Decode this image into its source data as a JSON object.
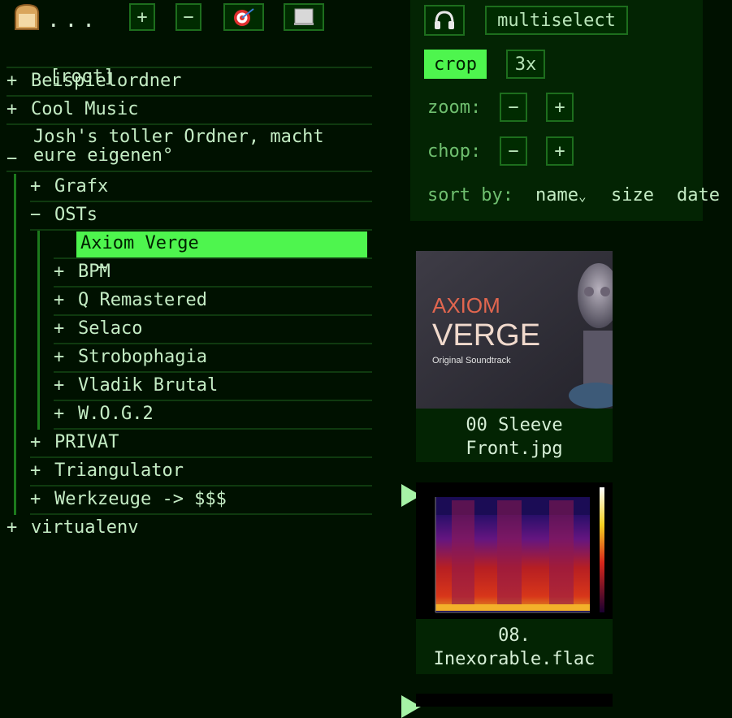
{
  "toolbar": {
    "dots": "...",
    "expand_label": "+",
    "collapse_label": "−",
    "bread_icon": "bread-icon",
    "target_icon": "target-icon",
    "sheet_icon": "sheet-icon"
  },
  "tree": {
    "root_label": "[root]",
    "items": [
      {
        "marker": "+",
        "label": "Beispielordner"
      },
      {
        "marker": "+",
        "label": "Cool Music"
      },
      {
        "marker": "−",
        "label_line1": "Josh's toller Ordner, macht",
        "label_line2": "eure eigenen°"
      },
      {
        "marker": "+",
        "label": "Grafx"
      },
      {
        "marker": "−",
        "label": "OSTs"
      },
      {
        "marker": "−",
        "label": "Axiom Verge"
      },
      {
        "marker": "+",
        "label": "BPM"
      },
      {
        "marker": "+",
        "label": "Q Remastered"
      },
      {
        "marker": "+",
        "label": "Selaco"
      },
      {
        "marker": "+",
        "label": "Strobophagia"
      },
      {
        "marker": "+",
        "label": "Vladik Brutal"
      },
      {
        "marker": "+",
        "label": "W.O.G.2"
      },
      {
        "marker": "+",
        "label": "PRIVAT"
      },
      {
        "marker": "+",
        "label": "Triangulator"
      },
      {
        "marker": "+",
        "label": "Werkzeuge -> $$$"
      },
      {
        "marker": "+",
        "label": "virtualenv"
      }
    ]
  },
  "panel": {
    "headphones_icon": "headphones-icon",
    "multiselect_label": "multiselect",
    "crop_label": "crop",
    "scale_label": "3x",
    "zoom_label": "zoom:",
    "chop_label": "chop:",
    "minus_label": "−",
    "plus_label": "+",
    "sort_label": "sort by:",
    "sort_options": [
      "name",
      "size",
      "date"
    ],
    "sort_selected": "name",
    "sort_indicator": "⌄"
  },
  "files": [
    {
      "name_line1": "00 Sleeve",
      "name_line2": "Front.jpg",
      "cover_title1": "AXIOM",
      "cover_title2": "VERGE",
      "cover_sub": "Original Soundtrack"
    },
    {
      "name_line1": "08.",
      "name_line2": "Inexorable.flac"
    }
  ],
  "colors": {
    "accent": "#4ef54e",
    "background": "#001100",
    "border": "#1d6e1d"
  }
}
